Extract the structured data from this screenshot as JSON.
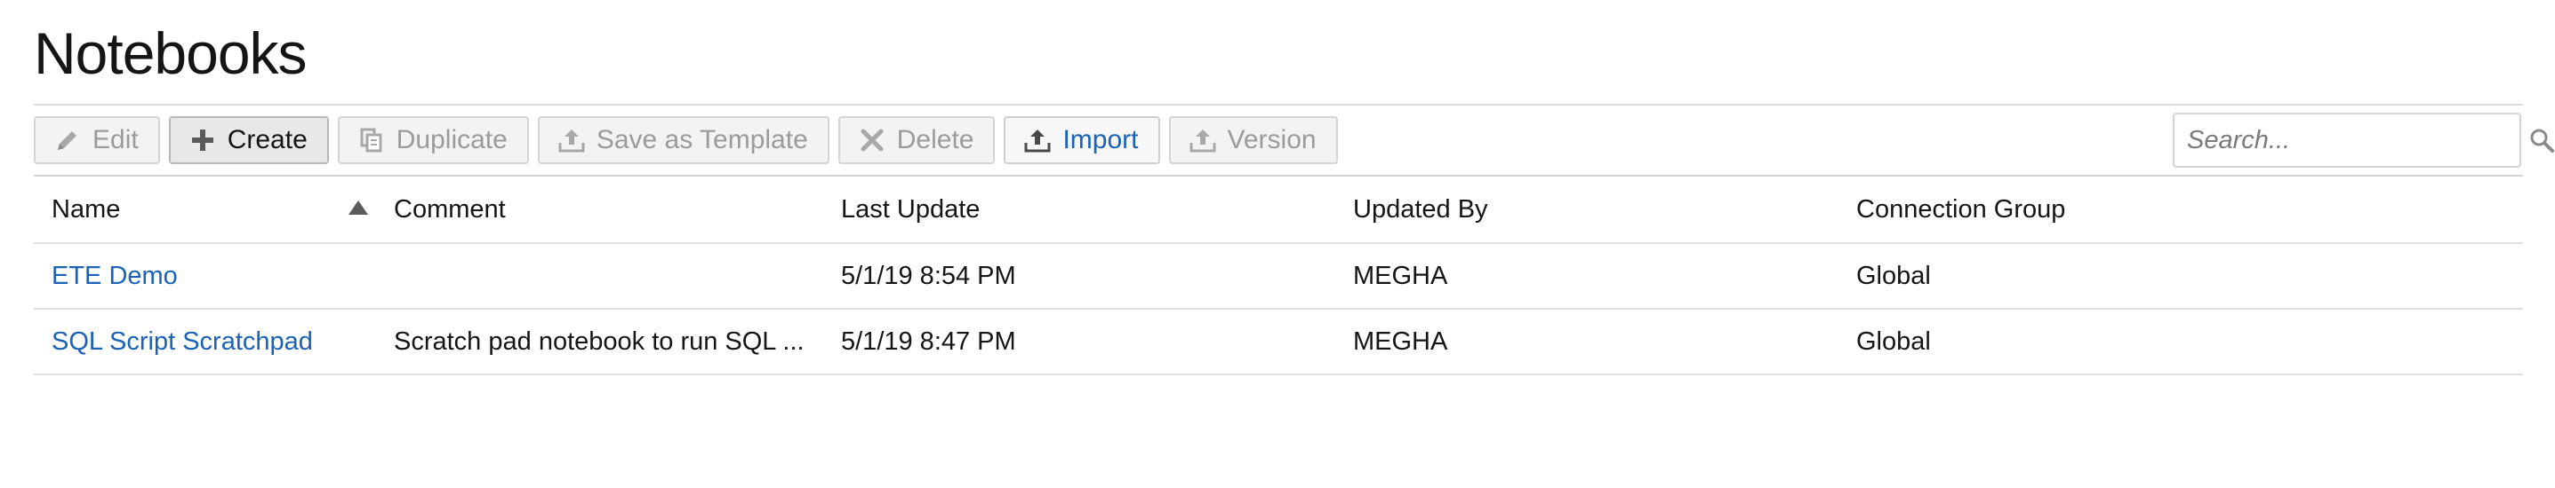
{
  "page": {
    "title": "Notebooks"
  },
  "toolbar": {
    "edit_label": "Edit",
    "create_label": "Create",
    "duplicate_label": "Duplicate",
    "save_template_label": "Save as Template",
    "delete_label": "Delete",
    "import_label": "Import",
    "version_label": "Version"
  },
  "search": {
    "placeholder": "Search...",
    "value": ""
  },
  "table": {
    "columns": [
      "Name",
      "Comment",
      "Last Update",
      "Updated By",
      "Connection Group"
    ],
    "sort": {
      "column": "Name",
      "direction": "ascending"
    },
    "rows": [
      {
        "name": "ETE Demo",
        "comment": "",
        "last_update": "5/1/19 8:54 PM",
        "updated_by": "MEGHA",
        "connection_group": "Global"
      },
      {
        "name": "SQL Script Scratchpad",
        "comment": "Scratch pad notebook to run SQL ...",
        "last_update": "5/1/19 8:47 PM",
        "updated_by": "MEGHA",
        "connection_group": "Global"
      }
    ]
  },
  "colors": {
    "link": "#1a62b8",
    "disabled_text": "#9b9b9b",
    "text": "#161513"
  },
  "icons": [
    "pencil-icon",
    "plus-icon",
    "duplicate-icon",
    "upload-icon",
    "x-icon",
    "search-icon",
    "sort-ascending-icon"
  ]
}
